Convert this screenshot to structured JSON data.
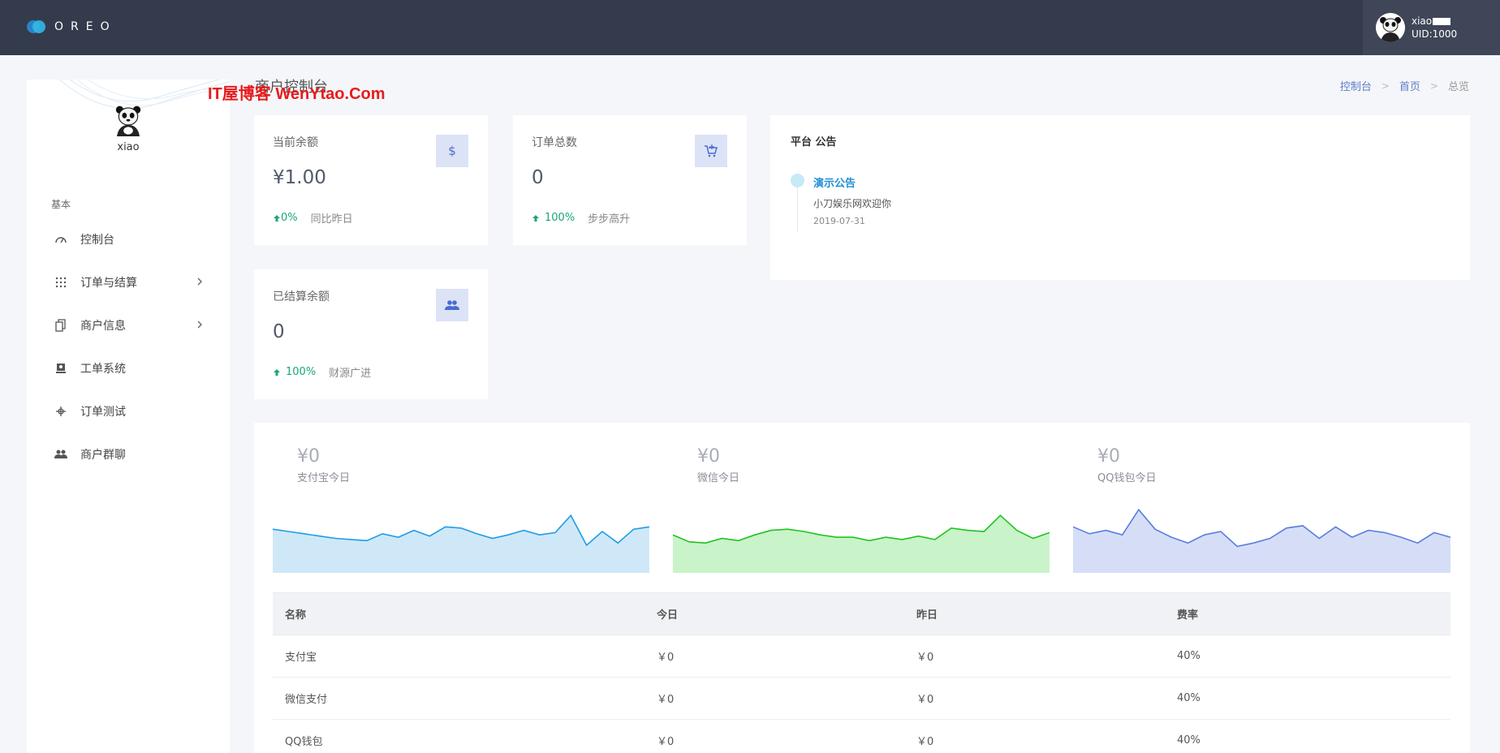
{
  "header": {
    "logo_text": "OREO",
    "user_name": "xiao",
    "user_uid": "UID:1000"
  },
  "sidebar": {
    "profile_name": "xiao",
    "section_label": "基本",
    "items": [
      {
        "label": "控制台",
        "icon": "speedometer-icon",
        "has_children": false
      },
      {
        "label": "订单与结算",
        "icon": "grid-dots-icon",
        "has_children": true
      },
      {
        "label": "商户信息",
        "icon": "copy-document-icon",
        "has_children": true
      },
      {
        "label": "工单系统",
        "icon": "ticket-user-icon",
        "has_children": false
      },
      {
        "label": "订单测试",
        "icon": "test-tube-icon",
        "has_children": false
      },
      {
        "label": "商户群聊",
        "icon": "group-users-icon",
        "has_children": false
      }
    ]
  },
  "watermark": "IT屋博客 WenYtao.Com",
  "page_title": "商户控制台",
  "breadcrumb": {
    "items": [
      "控制台",
      "首页"
    ],
    "current": "总览"
  },
  "stats": [
    {
      "label": "当前余额",
      "value": "¥1.00",
      "icon": "dollar-icon",
      "trend": "0%",
      "trend_text": "同比昨日"
    },
    {
      "label": "订单总数",
      "value": "0",
      "icon": "cart-add-icon",
      "trend": "100%",
      "trend_text": "步步高升"
    },
    {
      "label": "已结算余额",
      "value": "0",
      "icon": "users-icon",
      "trend": "100%",
      "trend_text": "财源广进"
    }
  ],
  "announcement": {
    "title": "平台 公告",
    "item_title": "演示公告",
    "item_body": "小刀娱乐网欢迎你",
    "item_date": "2019-07-31"
  },
  "payments": [
    {
      "amount": "¥0",
      "label": "支付宝今日",
      "color": "#1e9ce6",
      "fill": "#cfe8f8",
      "points": [
        38,
        36,
        34,
        32,
        30,
        29,
        28,
        34,
        31,
        37,
        32,
        40,
        39,
        34,
        30,
        33,
        37,
        33,
        35,
        50,
        24,
        36,
        26,
        38,
        40
      ]
    },
    {
      "amount": "¥0",
      "label": "微信今日",
      "color": "#1fc41f",
      "fill": "#c9f3c9",
      "points": [
        33,
        27,
        26,
        30,
        28,
        33,
        37,
        38,
        36,
        33,
        31,
        31,
        28,
        31,
        29,
        32,
        29,
        39,
        37,
        36,
        50,
        37,
        30,
        35
      ]
    },
    {
      "amount": "¥0",
      "label": "QQ钱包今日",
      "color": "#5a7ee0",
      "fill": "#d6def7",
      "points": [
        40,
        34,
        37,
        33,
        55,
        38,
        31,
        26,
        33,
        36,
        23,
        26,
        30,
        39,
        41,
        30,
        40,
        31,
        37,
        35,
        31,
        26,
        35,
        31
      ]
    }
  ],
  "table": {
    "headers": [
      "名称",
      "今日",
      "昨日",
      "费率"
    ],
    "rows": [
      [
        "支付宝",
        "￥0",
        "￥0",
        "40%"
      ],
      [
        "微信支付",
        "￥0",
        "￥0",
        "40%"
      ],
      [
        "QQ钱包",
        "￥0",
        "￥0",
        "40%"
      ]
    ]
  }
}
